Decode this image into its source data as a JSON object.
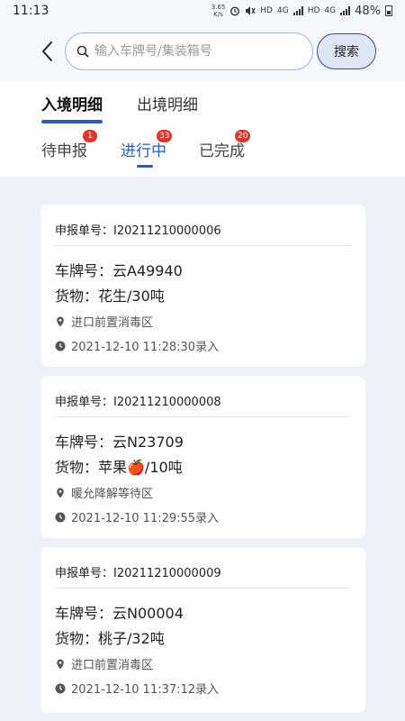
{
  "status_bar": {
    "time": "11:13",
    "net_speed_value": "3.65",
    "net_speed_unit": "K/s",
    "network_1": "HD",
    "network_2": "4G",
    "network_3": "HD",
    "network_4": "4G",
    "battery": "48%"
  },
  "search": {
    "placeholder": "输入车牌号/集装箱号",
    "value": "",
    "button_label": "搜索"
  },
  "main_tabs": [
    {
      "label": "入境明细",
      "active": true
    },
    {
      "label": "出境明细",
      "active": false
    }
  ],
  "sub_tabs": [
    {
      "label": "待申报",
      "badge": "1",
      "active": false
    },
    {
      "label": "进行中",
      "badge": "33",
      "active": true
    },
    {
      "label": "已完成",
      "badge": "20",
      "active": false
    }
  ],
  "records": [
    {
      "declaration": "申报单号：I20211210000006",
      "plate": "车牌号：云A49940",
      "cargo": "货物：花生/30吨",
      "location": "进口前置消毒区",
      "time": "2021-12-10 11:28:30录入"
    },
    {
      "declaration": "申报单号：I20211210000008",
      "plate": "车牌号：云N23709",
      "cargo": "货物：苹果🍎/10吨",
      "location": "暖允降解等待区",
      "time": "2021-12-10 11:29:55录入"
    },
    {
      "declaration": "申报单号：I20211210000009",
      "plate": "车牌号：云N00004",
      "cargo": "货物：桃子/32吨",
      "location": "进口前置消毒区",
      "time": "2021-12-10 11:37:12录入"
    }
  ],
  "colors": {
    "accent": "#2c5ac8",
    "badge": "#e5322d",
    "background": "#eef2f8"
  }
}
